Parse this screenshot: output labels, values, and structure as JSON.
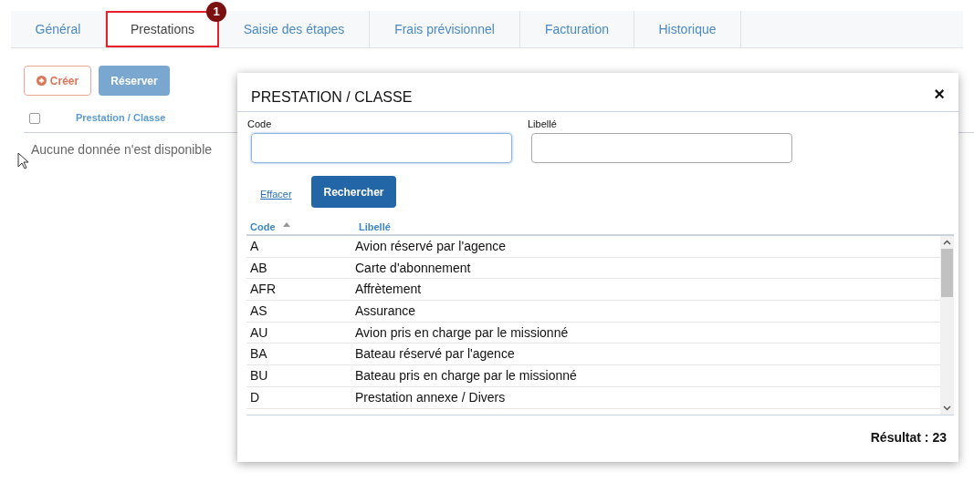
{
  "tabs": [
    {
      "label": "Général",
      "selected": false
    },
    {
      "label": "Prestations",
      "selected": true,
      "badge": "1"
    },
    {
      "label": "Saisie des étapes",
      "selected": false
    },
    {
      "label": "Frais prévisionnel",
      "selected": false
    },
    {
      "label": "Facturation",
      "selected": false
    },
    {
      "label": "Historique",
      "selected": false
    }
  ],
  "toolbar": {
    "create": "Créer",
    "reserve": "Réserver"
  },
  "table": {
    "select_all_checked": false,
    "column": "Prestation / Classe",
    "empty": "Aucune donnée n'est disponible"
  },
  "dialog": {
    "title": "PRESTATION / CLASSE",
    "close": "×",
    "fields": [
      {
        "label": "Code",
        "focused": true
      },
      {
        "label": "Libellé",
        "focused": false
      }
    ],
    "clear": "Effacer",
    "search": "Rechercher",
    "columns": [
      "Code",
      "Libellé"
    ],
    "rows": [
      {
        "code": "A",
        "label": "Avion réservé par l'agence"
      },
      {
        "code": "AB",
        "label": "Carte d'abonnement"
      },
      {
        "code": "AFR",
        "label": "Affrètement"
      },
      {
        "code": "AS",
        "label": "Assurance"
      },
      {
        "code": "AU",
        "label": "Avion pris en charge par le missionné"
      },
      {
        "code": "BA",
        "label": "Bateau réservé par l'agence"
      },
      {
        "code": "BU",
        "label": "Bateau pris en charge par le missionné"
      },
      {
        "code": "D",
        "label": "Prestation annexe / Divers"
      }
    ],
    "result": "Résultat : 23"
  }
}
